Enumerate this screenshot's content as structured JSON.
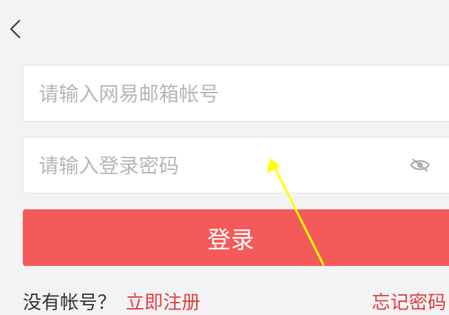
{
  "header": {
    "back_icon": "chevron-left-icon"
  },
  "form": {
    "username_placeholder": "请输入网易邮箱帐号",
    "password_placeholder": "请输入登录密码",
    "password_toggle_icon": "eye-off-icon",
    "login_label": "登录"
  },
  "footer": {
    "no_account_text": "没有帐号？",
    "register_label": "立即注册",
    "forgot_label": "忘记密码"
  },
  "colors": {
    "background": "#f3f3f5",
    "accent": "#f45a59",
    "link": "#e0403f",
    "annotation": "#ffff00"
  }
}
